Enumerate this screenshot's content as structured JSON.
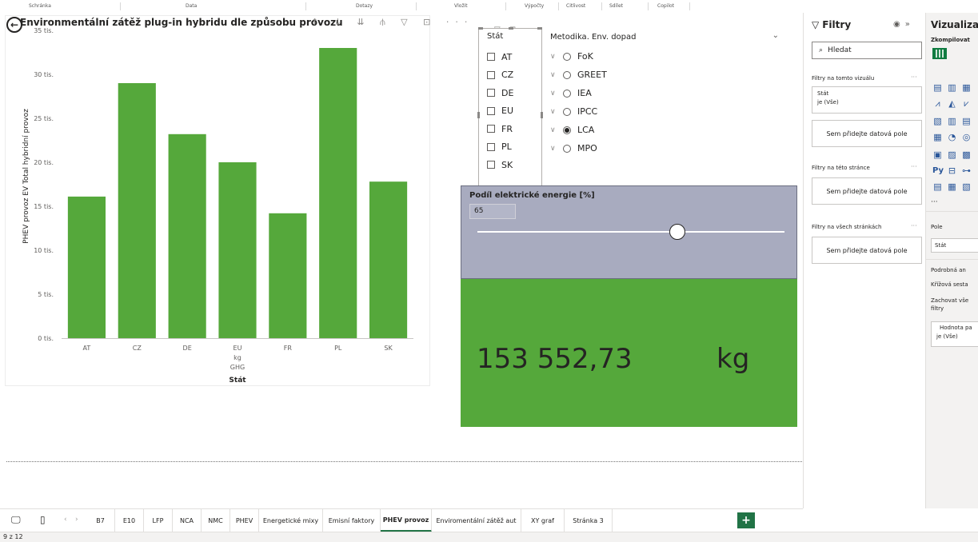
{
  "ribbon": {
    "groups": [
      "Schránka",
      "Data",
      "Dotazy",
      "Vložit",
      "Výpočty",
      "Citlivost",
      "Sdílet",
      "Copilot"
    ]
  },
  "bar_visual": {
    "title": "Environmentální zátěž plug-in hybridu dle způsobu provozu",
    "header_icons": "↑ ↓ ⇊ ⫛ ▽ ⊡ ···"
  },
  "chart_data": {
    "type": "bar",
    "categories": [
      "AT",
      "CZ",
      "DE",
      "EU",
      "FR",
      "PL",
      "SK"
    ],
    "values": [
      16100,
      29000,
      23200,
      20000,
      14200,
      33000,
      17800
    ],
    "ylabel": "PHEV provoz EV Total hybridní provoz",
    "xlabel": "Stát",
    "x_sublabels": [
      "kg",
      "GHG"
    ],
    "ylim": [
      0,
      35000
    ],
    "y_ticks": [
      0,
      5000,
      10000,
      15000,
      20000,
      25000,
      30000,
      35000
    ],
    "y_tick_labels": [
      "0 tis.",
      "5 tis.",
      "10 tis.",
      "15 tis.",
      "20 tis.",
      "25 tis.",
      "30 tis.",
      "35 tis."
    ],
    "bar_color": "#55a83b",
    "grid": false
  },
  "slicer_stat": {
    "title": "Stát",
    "items": [
      "AT",
      "CZ",
      "DE",
      "EU",
      "FR",
      "PL",
      "SK"
    ],
    "header_icons": "▽ ⊡ ···"
  },
  "slicer_metodika": {
    "title": "Metodika. Env. dopad",
    "items": [
      {
        "label": "FoK",
        "selected": false
      },
      {
        "label": "GREET",
        "selected": false
      },
      {
        "label": "IEA",
        "selected": false
      },
      {
        "label": "IPCC",
        "selected": false
      },
      {
        "label": "LCA",
        "selected": true
      },
      {
        "label": "MPO",
        "selected": false
      }
    ]
  },
  "slider": {
    "label": "Podíl elektrické energie [%]",
    "value": "65",
    "level_fraction": 0.65
  },
  "kpi": {
    "value": "153 552,73",
    "unit": "kg",
    "color": "#55a83b"
  },
  "filters_pane": {
    "title": "Filtry",
    "search_placeholder": "Hledat",
    "section_visual": "Filtry na tomto vizuálu",
    "filter_field": "Stát",
    "filter_value": "je (Vše)",
    "add_field": "Sem přidejte datová pole",
    "section_page": "Filtry na této stránce",
    "section_all": "Filtry na všech stránkách"
  },
  "viz_pane": {
    "title": "Vizualizac",
    "compile": "Zkompilovat",
    "pole_label": "Pole",
    "pole_value": "Stát",
    "drill_label": "Podrobná an",
    "cross_label": "Křížová sesta",
    "keep_label": "Zachovat vše",
    "keep_label2": "filtry",
    "value_label": "Hodnota pa",
    "value_value": "je (Vše)",
    "more": "···"
  },
  "tabs": [
    "B7",
    "E10",
    "LFP",
    "NCA",
    "NMC",
    "PHEV",
    "Energetické mixy",
    "Emisní faktory",
    "PHEV provoz",
    "Enviromentální zátěž aut",
    "XY graf",
    "Stránka 3"
  ],
  "active_tab": "PHEV provoz",
  "status": {
    "page": "9 z 12"
  }
}
